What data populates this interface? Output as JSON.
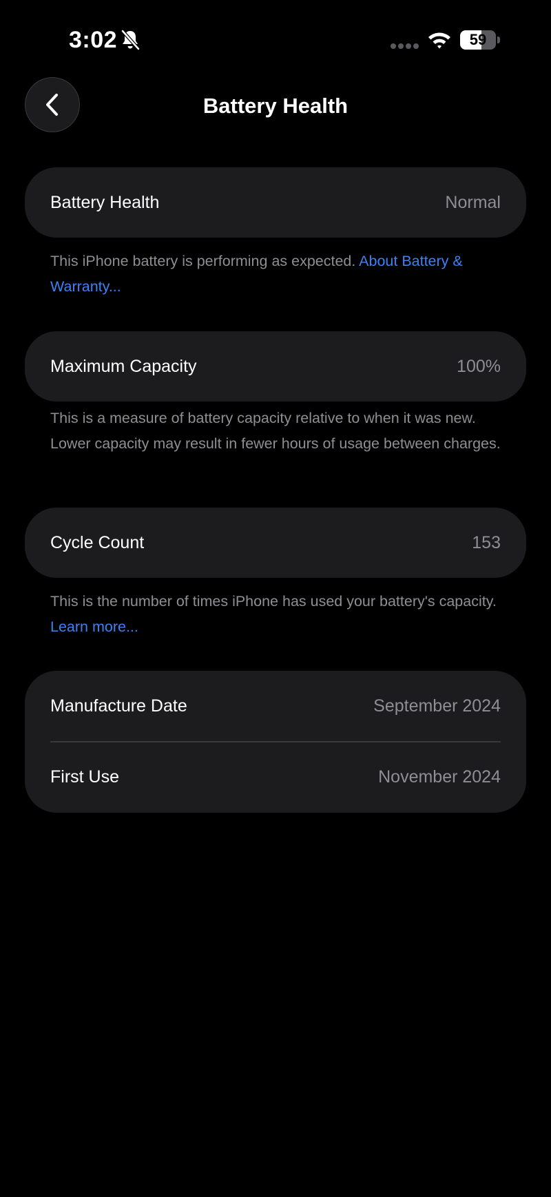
{
  "status_bar": {
    "time": "3:02",
    "battery_level": "59",
    "battery_fraction": 0.59,
    "icons": [
      "bell-slash-icon",
      "cellular-signal-icon",
      "wifi-icon",
      "battery-icon"
    ]
  },
  "nav": {
    "back_icon": "chevron-left-icon",
    "title": "Battery Health"
  },
  "battery_health": {
    "label": "Battery Health",
    "value": "Normal",
    "footnote_text": "This iPhone battery is performing as expected. ",
    "footnote_link": "About Battery & Warranty..."
  },
  "maximum_capacity": {
    "label": "Maximum Capacity",
    "value": "100%",
    "footnote_text": "This is a measure of battery capacity relative to when it was new. Lower capacity may result in fewer hours of usage between charges."
  },
  "cycle_count": {
    "label": "Cycle Count",
    "value": "153",
    "footnote_text": "This is the number of times iPhone has used your battery's capacity. ",
    "footnote_link": "Learn more..."
  },
  "dates": {
    "manufacture_label": "Manufacture Date",
    "manufacture_value": "September 2024",
    "first_use_label": "First Use",
    "first_use_value": "November 2024"
  },
  "colors": {
    "background": "#000000",
    "card": "#1c1c1e",
    "secondary_text": "#8e8e93",
    "link": "#3b82f6"
  }
}
